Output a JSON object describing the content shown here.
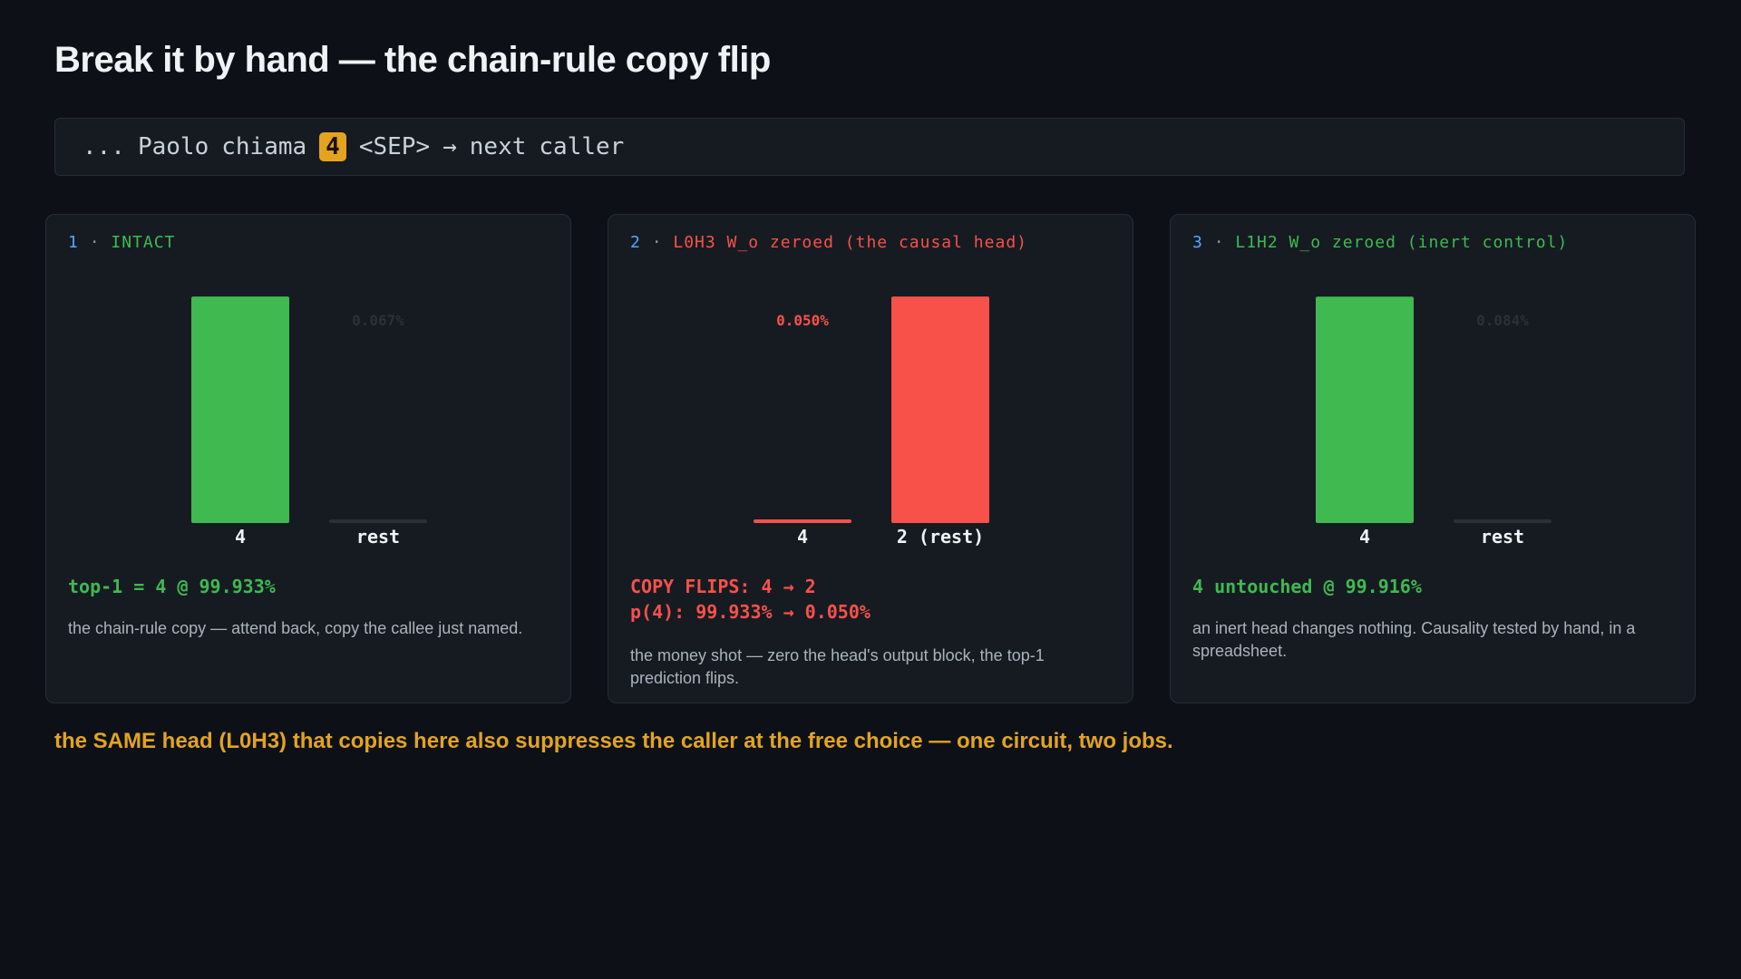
{
  "title": "Break it by hand — the chain-rule copy flip",
  "sequence": {
    "tokens": [
      "...",
      "Paolo",
      "chiama",
      "4",
      "<SEP>",
      "→",
      "next",
      "caller"
    ],
    "highlight_index": 3
  },
  "colors": {
    "green": "#3fb950",
    "red": "#f85149",
    "blue": "#58a6ff",
    "amber": "#e3a321",
    "faint": "#2a3038",
    "muted_text": "#aab3bd"
  },
  "panels": [
    {
      "num": "1",
      "sep": "·",
      "title": "INTACT",
      "accent": "#3fb950",
      "result_lines": [
        "top-1 = 4 @ 99.933%"
      ],
      "description": "the chain-rule copy — attend back, copy the callee just named."
    },
    {
      "num": "2",
      "sep": "·",
      "title": "L0H3 W_o zeroed (the causal head)",
      "accent": "#f85149",
      "result_lines": [
        "COPY FLIPS: 4 → 2",
        "p(4): 99.933% → 0.050%"
      ],
      "description": "the money shot — zero the head's output block, the top-1 prediction flips."
    },
    {
      "num": "3",
      "sep": "·",
      "title": "L1H2 W_o zeroed (inert control)",
      "accent": "#3fb950",
      "result_lines": [
        "4 untouched @ 99.916%"
      ],
      "description": "an inert head changes nothing. Causality tested by hand, in a spreadsheet."
    }
  ],
  "chart_data": [
    {
      "type": "bar",
      "title": "INTACT",
      "categories": [
        "4",
        "rest"
      ],
      "values": [
        99.933,
        0.067
      ],
      "value_labels": [
        "99.933%",
        "0.067%"
      ],
      "colors": [
        "#3fb950",
        "#2a3038"
      ],
      "label_colors": [
        "#3fb950",
        "#2a3038"
      ],
      "ylim": [
        0,
        100
      ],
      "unit": "%"
    },
    {
      "type": "bar",
      "title": "L0H3 W_o zeroed (the causal head)",
      "categories": [
        "4",
        "2 (rest)"
      ],
      "values": [
        0.05,
        99.95
      ],
      "value_labels": [
        "0.050%",
        "99.950%"
      ],
      "colors": [
        "#f85149",
        "#f85149"
      ],
      "label_colors": [
        "#f85149",
        "#f85149"
      ],
      "ylim": [
        0,
        100
      ],
      "unit": "%"
    },
    {
      "type": "bar",
      "title": "L1H2 W_o zeroed (inert control)",
      "categories": [
        "4",
        "rest"
      ],
      "values": [
        99.916,
        0.084
      ],
      "value_labels": [
        "99.916%",
        "0.084%"
      ],
      "colors": [
        "#3fb950",
        "#2a3038"
      ],
      "label_colors": [
        "#3fb950",
        "#2a3038"
      ],
      "ylim": [
        0,
        100
      ],
      "unit": "%"
    }
  ],
  "footer": "the SAME head (L0H3) that copies here also suppresses the caller at the free choice — one circuit, two jobs."
}
